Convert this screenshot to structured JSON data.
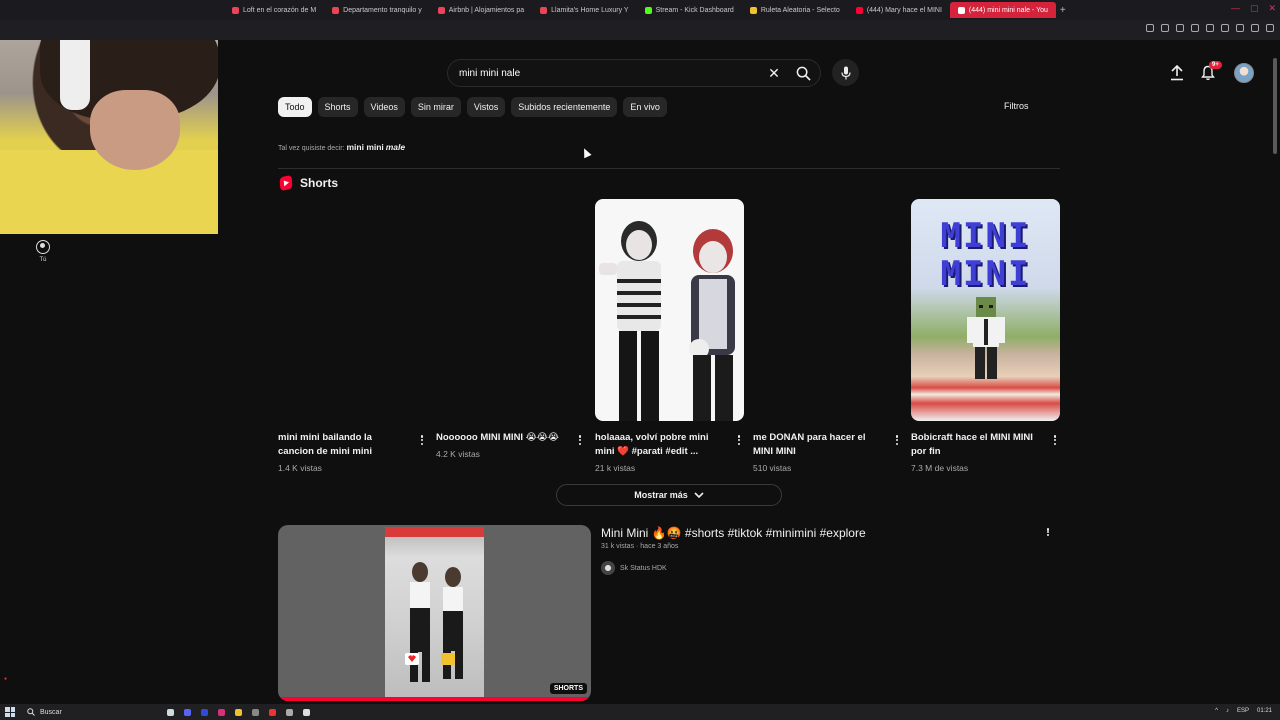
{
  "browser": {
    "tabs": [
      {
        "title": "Loft en el corazón de M",
        "color": "#e8445a"
      },
      {
        "title": "Departamento tranquilo y",
        "color": "#e8445a"
      },
      {
        "title": "Airbnb | Alojamientos pa",
        "color": "#e8445a"
      },
      {
        "title": "Llamita's Home Luxury Y",
        "color": "#e8445a"
      },
      {
        "title": "Stream - Kick Dashboard",
        "color": "#53fc18"
      },
      {
        "title": "Ruleta Aleatoria - Selecto",
        "color": "#f2c12e"
      },
      {
        "title": "(444) Mary hace el MINI",
        "color": "#ff0033"
      },
      {
        "title": "(444) mini mini nale - You",
        "color": "#ff0033",
        "active": true
      }
    ],
    "new_tab": "+"
  },
  "guide": {
    "you_label": "Tú"
  },
  "search": {
    "value": "mini mini nale",
    "clear": "✕"
  },
  "header": {
    "notif_badge": "9+"
  },
  "chips": [
    "Todo",
    "Shorts",
    "Videos",
    "Sin mirar",
    "Vistos",
    "Subidos recientemente",
    "En vivo"
  ],
  "filters_label": "Filtros",
  "suggestion": {
    "prefix": "Tal vez quisiste decir:",
    "plain": "mini mini",
    "corrected": "male"
  },
  "shorts_shelf": {
    "title": "Shorts",
    "items": [
      {
        "title": "mini mini bailando la cancion de mini mini",
        "views": "1.4 K vistas",
        "thumb": "empty"
      },
      {
        "title": "Noooooo MINI MINI 😭😭😭",
        "views": "4.2 K vistas",
        "thumb": "empty"
      },
      {
        "title": "holaaaa, volví pobre mini mini ❤️ #parati #edit ...",
        "views": "21 k vistas",
        "thumb": "clowns"
      },
      {
        "title": "me DONAN para hacer el MINI MINI",
        "views": "510 vistas",
        "thumb": "empty"
      },
      {
        "title": "Bobicraft hace el MINI MINI por fin",
        "views": "7.3 M de vistas",
        "thumb": "minecraft",
        "thumb_text": "MINI MINI"
      }
    ],
    "show_more": "Mostrar más"
  },
  "video": {
    "title": "Mini Mini 🔥🤬 #shorts #tiktok #minimini #explore",
    "meta": "31 k vistas · hace 3 años",
    "channel": "Sk Status HDK",
    "badge": "SHORTS"
  },
  "taskbar": {
    "search_label": "Buscar",
    "lang": "ESP",
    "time": "01:21"
  }
}
